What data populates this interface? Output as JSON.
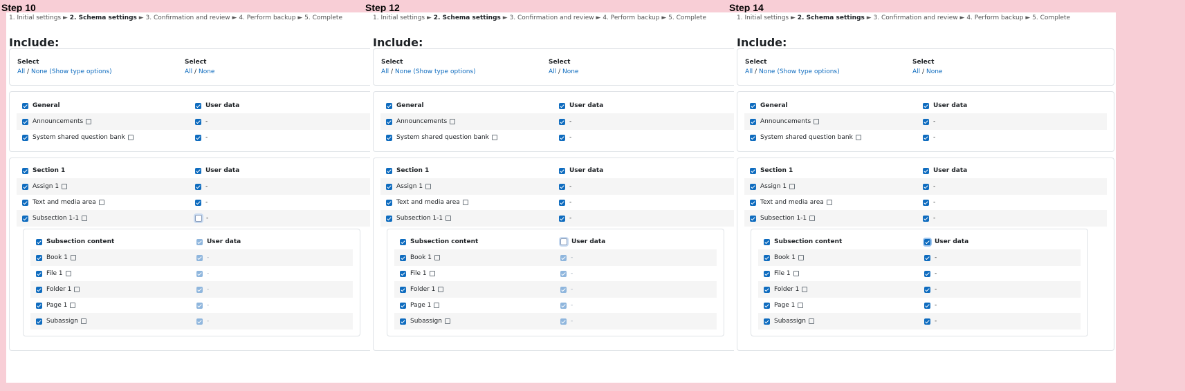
{
  "breadcrumb": {
    "step1": "1. Initial settings",
    "sep": "►",
    "step2": "2. Schema settings",
    "step3": "3. Confirmation and review",
    "step4": "4. Perform backup",
    "step5": "5. Complete"
  },
  "include_heading": "Include:",
  "select": {
    "title": "Select",
    "all": "All",
    "slash": "/",
    "none": "None",
    "show_type_options": "(Show type options)"
  },
  "labels": {
    "general": "General",
    "user_data": "User data",
    "announcements": "Announcements",
    "system_qbank": "System shared question bank",
    "section1": "Section 1",
    "assign1": "Assign 1",
    "text_media": "Text and media area",
    "subsection": "Subsection 1-1",
    "subsection_content": "Subsection content",
    "book1": "Book 1",
    "file1": "File 1",
    "folder1": "Folder 1",
    "page1": "Page 1",
    "subassign": "Subassign",
    "dash": "-"
  },
  "panels": [
    {
      "step": "Step 10",
      "subsection_userdata": "focus-unchecked",
      "subsection_content_userdata": "light"
    },
    {
      "step": "Step 12",
      "subsection_userdata": "checked",
      "subsection_content_userdata": "unchecked"
    },
    {
      "step": "Step 14",
      "subsection_userdata": "checked",
      "subsection_content_userdata": "checked-focus"
    }
  ]
}
